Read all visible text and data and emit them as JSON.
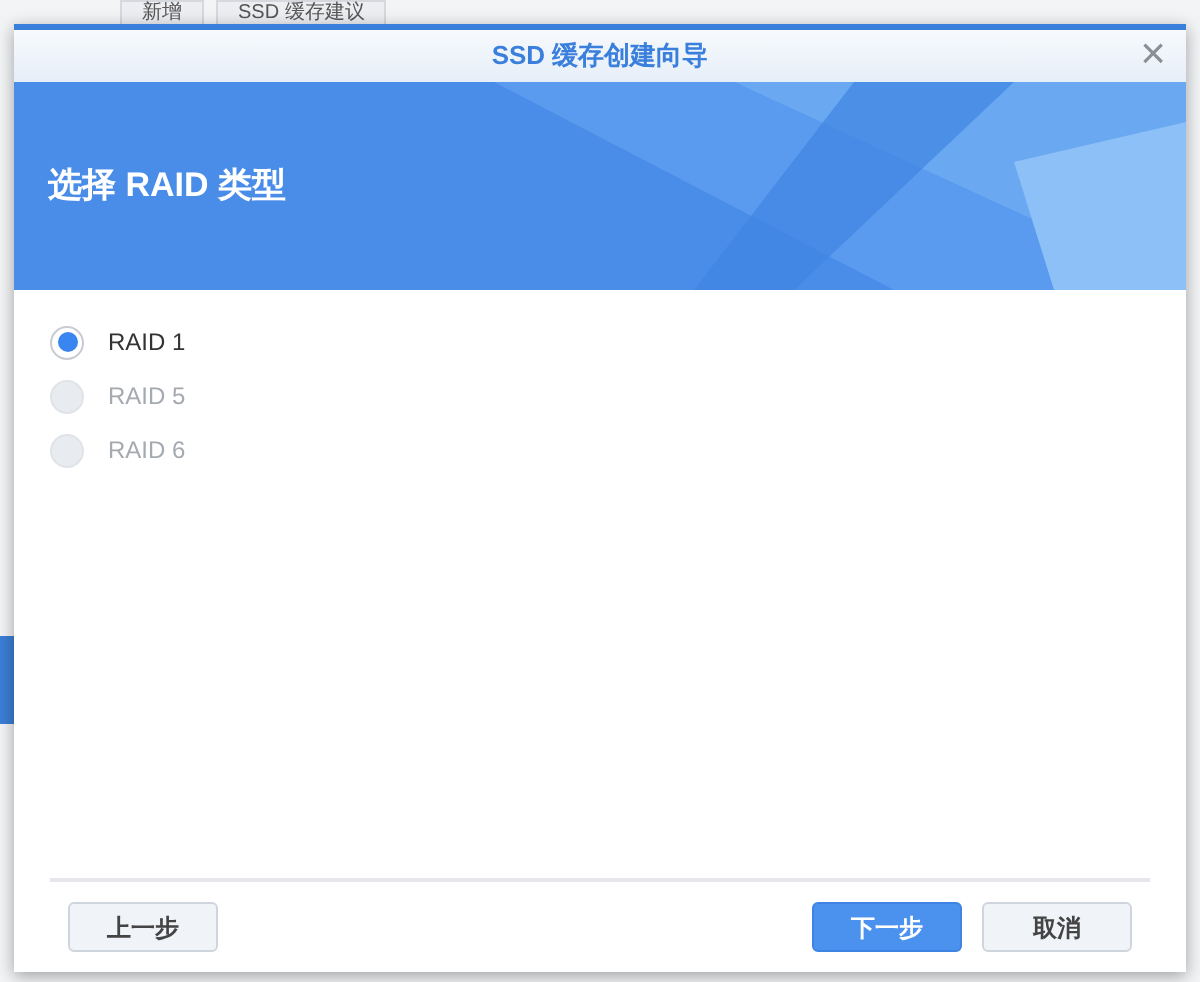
{
  "background_tabs": [
    {
      "label": "新增"
    },
    {
      "label": "SSD 缓存建议"
    }
  ],
  "window": {
    "title": "SSD 缓存创建向导",
    "close": "×"
  },
  "banner": {
    "heading": "选择 RAID 类型"
  },
  "options": [
    {
      "label": "RAID 1",
      "selected": true,
      "disabled": false
    },
    {
      "label": "RAID 5",
      "selected": false,
      "disabled": true
    },
    {
      "label": "RAID 6",
      "selected": false,
      "disabled": true
    }
  ],
  "buttons": [
    {
      "label": "上一步",
      "kind": "secondary"
    },
    {
      "label": "下一步",
      "kind": "primary"
    },
    {
      "label": "取消",
      "kind": "secondary"
    }
  ]
}
